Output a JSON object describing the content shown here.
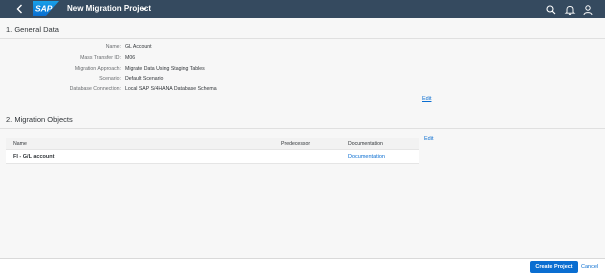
{
  "shell": {
    "logo_text": "SAP",
    "title": "New Migration Project",
    "icons": [
      "back-icon",
      "search-icon",
      "bell-icon",
      "user-icon"
    ],
    "colors": {
      "shellbar": "#354a5f",
      "logo": "#0a6ed1",
      "accent": "#0a6ed1"
    }
  },
  "general": {
    "title": "1. General Data",
    "fields": [
      {
        "label": "Name:",
        "value": "GL Account"
      },
      {
        "label": "Mass Transfer ID:",
        "value": "M06"
      },
      {
        "label": "Migration Approach:",
        "value": "Migrate Data Using Staging Tables"
      },
      {
        "label": "Scenario:",
        "value": "Default Scenario"
      },
      {
        "label": "Database Connection:",
        "value": "Local SAP S/4HANA Database Schema"
      }
    ],
    "edit_label": "Edit"
  },
  "objects": {
    "title": "2. Migration Objects",
    "edit_label": "Edit",
    "columns": [
      "Name",
      "Predecessor",
      "Documentation"
    ],
    "rows": [
      {
        "name": "FI - G/L account",
        "predecessor": "",
        "documentation": "Documentation"
      }
    ]
  },
  "footer": {
    "create_label": "Create Project",
    "cancel_label": "Cancel"
  }
}
